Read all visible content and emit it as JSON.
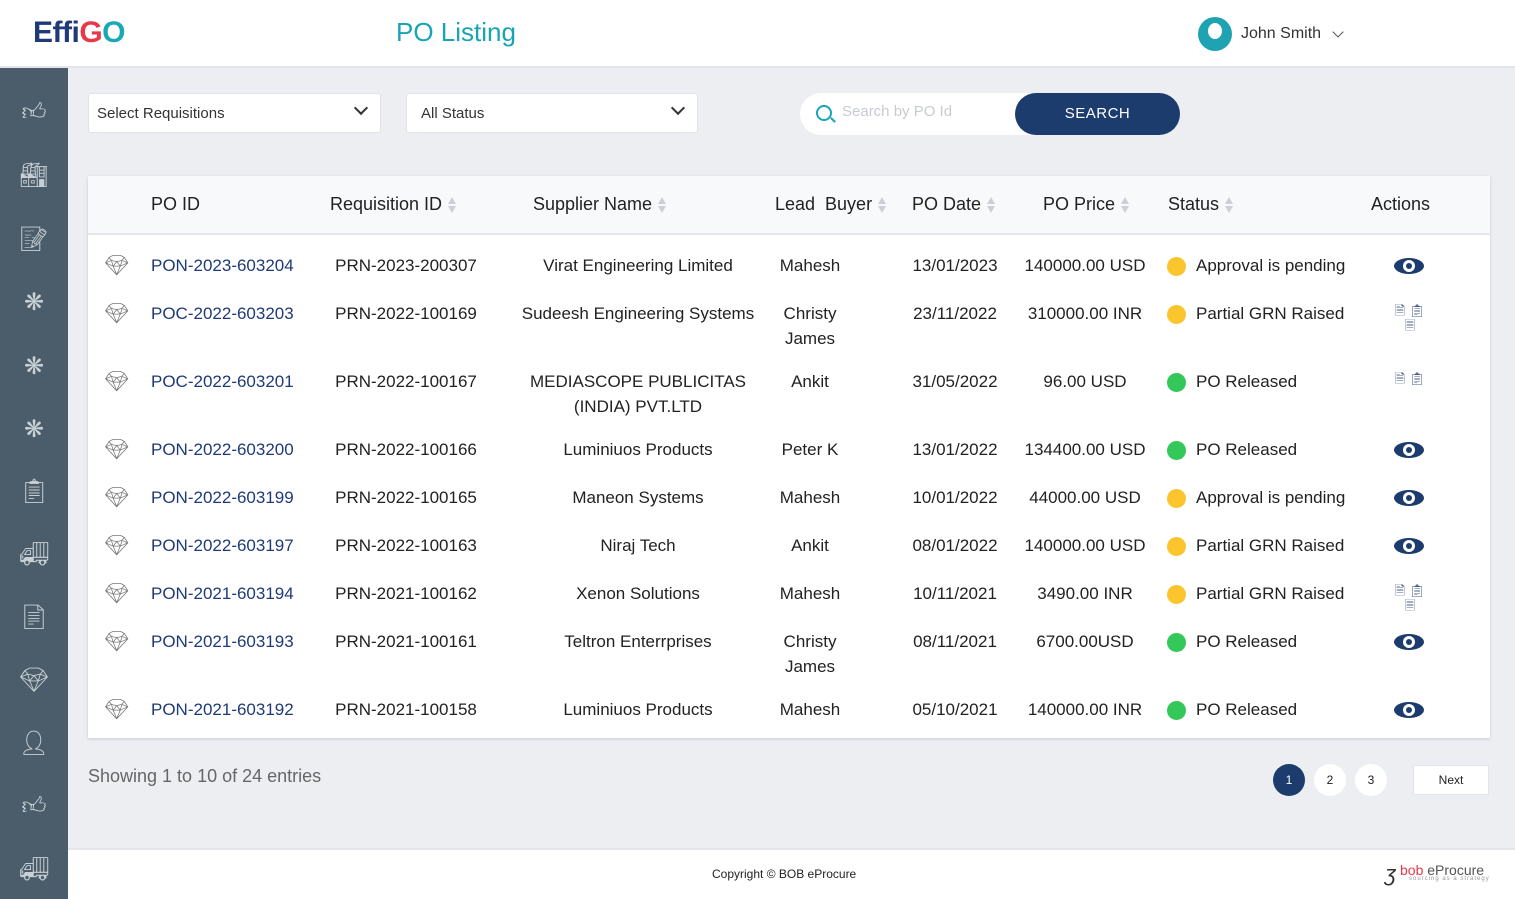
{
  "header": {
    "logo": "EffiGO",
    "title": "PO Listing",
    "user": "John Smith"
  },
  "sidebar": {
    "icons": [
      "thumbs-up-icon",
      "factory-icon",
      "edit-document-icon",
      "network-icon",
      "network-icon",
      "network-icon",
      "checklist-icon",
      "truck-icon",
      "invoice-icon",
      "gem-icon",
      "user-settings-icon",
      "thumbs-up-icon",
      "truck-icon"
    ]
  },
  "filters": {
    "requisition": "Select Requisitions",
    "status": "All Status",
    "search_placeholder": "Search by PO Id",
    "search_button": "SEARCH"
  },
  "table": {
    "headers": [
      "PO ID",
      "Requisition ID",
      "Supplier Name",
      "Lead  Buyer",
      "PO Date",
      "PO Price",
      "Status",
      "Actions"
    ],
    "rows": [
      {
        "po_id": "PON-2023-603204",
        "req_id": "PRN-2023-200307",
        "supplier": "Virat Engineering Limited",
        "buyer": "Mahesh",
        "date": "13/01/2023",
        "price": "140000.00 USD",
        "status": "Approval is pending",
        "status_color": "#fbc52d",
        "action": "view"
      },
      {
        "po_id": "POC-2022-603203",
        "req_id": "PRN-2022-100169",
        "supplier": "Sudeesh Engineering Systems",
        "buyer": "Christy James",
        "date": "23/11/2022",
        "price": "310000.00 INR",
        "status": "Partial GRN Raised",
        "status_color": "#fbc52d",
        "action": "documents"
      },
      {
        "po_id": "POC-2022-603201",
        "req_id": "PRN-2022-100167",
        "supplier": "MEDIASCOPE PUBLICITAS (INDIA) PVT.LTD",
        "buyer": "Ankit",
        "date": "31/05/2022",
        "price": "96.00 USD",
        "status": "PO Released",
        "status_color": "#34c759",
        "action": "documents-short"
      },
      {
        "po_id": "PON-2022-603200",
        "req_id": "PRN-2022-100166",
        "supplier": "Luminiuos Products",
        "buyer": "Peter K",
        "date": "13/01/2022",
        "price": "134400.00 USD",
        "status": "PO Released",
        "status_color": "#34c759",
        "action": "view"
      },
      {
        "po_id": "PON-2022-603199",
        "req_id": "PRN-2022-100165",
        "supplier": "Maneon Systems",
        "buyer": "Mahesh",
        "date": "10/01/2022",
        "price": "44000.00 USD",
        "status": "Approval is pending",
        "status_color": "#fbc52d",
        "action": "view"
      },
      {
        "po_id": "PON-2022-603197",
        "req_id": "PRN-2022-100163",
        "supplier": "Niraj Tech",
        "buyer": "Ankit",
        "date": "08/01/2022",
        "price": "140000.00 USD",
        "status": "Partial GRN Raised",
        "status_color": "#fbc52d",
        "action": "view"
      },
      {
        "po_id": "PON-2021-603194",
        "req_id": "PRN-2021-100162",
        "supplier": "Xenon Solutions",
        "buyer": "Mahesh",
        "date": "10/11/2021",
        "price": "3490.00 INR",
        "status": "Partial GRN Raised",
        "status_color": "#fbc52d",
        "action": "documents"
      },
      {
        "po_id": "PON-2021-603193",
        "req_id": "PRN-2021-100161",
        "supplier": "Teltron Enterrprises",
        "buyer": "Christy James",
        "date": "08/11/2021",
        "price": "6700.00USD",
        "status": "PO Released",
        "status_color": "#34c759",
        "action": "view"
      },
      {
        "po_id": "PON-2021-603192",
        "req_id": "PRN-2021-100158",
        "supplier": "Luminiuos Products",
        "buyer": "Mahesh",
        "date": "05/10/2021",
        "price": "140000.00 INR",
        "status": "PO Released",
        "status_color": "#34c759",
        "action": "view"
      }
    ]
  },
  "pagination": {
    "info": "Showing 1 to 10 of 24 entries",
    "pages": [
      "1",
      "2",
      "3"
    ],
    "current": "1",
    "next": "Next"
  },
  "footer": {
    "copyright": "Copyright © BOB eProcure",
    "brand": "bob eProcure",
    "tagline": "sourcing as a strategy"
  },
  "colors": {
    "primary": "#1d3c6e",
    "accent": "#18a4b4",
    "sidebar": "#4b5d6a",
    "pending": "#fbc52d",
    "released": "#34c759"
  }
}
